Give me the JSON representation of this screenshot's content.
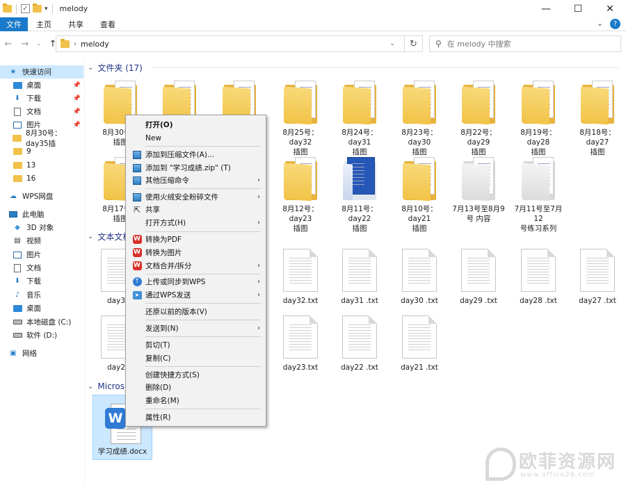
{
  "window": {
    "title": "melody"
  },
  "ribbon": {
    "tabs": [
      "文件",
      "主页",
      "共享",
      "查看"
    ]
  },
  "address": {
    "path": "melody",
    "search_placeholder": "在 melody 中搜索"
  },
  "sidebar": {
    "items": [
      {
        "label": "快速访问",
        "icon": "star-icon"
      },
      {
        "label": "桌面",
        "icon": "desktop-icon",
        "pinned": true
      },
      {
        "label": "下载",
        "icon": "download-icon",
        "pinned": true
      },
      {
        "label": "文档",
        "icon": "document-icon",
        "pinned": true
      },
      {
        "label": "图片",
        "icon": "picture-icon",
        "pinned": true
      },
      {
        "label": "8月30号：day35插",
        "icon": "folder-icon"
      },
      {
        "label": "9",
        "icon": "folder-icon"
      },
      {
        "label": "13",
        "icon": "folder-icon"
      },
      {
        "label": "16",
        "icon": "folder-icon"
      },
      {
        "label": "WPS网盘",
        "icon": "cloud-icon"
      },
      {
        "label": "此电脑",
        "icon": "pc-icon"
      },
      {
        "label": "3D 对象",
        "icon": "3d-icon"
      },
      {
        "label": "视频",
        "icon": "video-icon"
      },
      {
        "label": "图片",
        "icon": "picture-icon"
      },
      {
        "label": "文档",
        "icon": "document-icon"
      },
      {
        "label": "下载",
        "icon": "download-icon"
      },
      {
        "label": "音乐",
        "icon": "music-icon"
      },
      {
        "label": "桌面",
        "icon": "desktop-icon"
      },
      {
        "label": "本地磁盘 (C:)",
        "icon": "drive-icon"
      },
      {
        "label": "软件 (D:)",
        "icon": "drive-icon"
      },
      {
        "label": "网络",
        "icon": "network-icon"
      }
    ]
  },
  "groups": {
    "folders": {
      "header": "文件夹 (17)"
    },
    "text_docs": {
      "header": "文本文档"
    },
    "microsoft": {
      "header": "Micros"
    }
  },
  "folders_row1": [
    {
      "label1": "8月30号：",
      "label2": "插图"
    },
    {
      "label1": "",
      "label2": ""
    },
    {
      "label1": "",
      "label2": ""
    },
    {
      "label1": "8月25号：day32",
      "label2": "插图"
    },
    {
      "label1": "8月24号：day31",
      "label2": "插图"
    },
    {
      "label1": "8月23号：day30",
      "label2": "插图"
    },
    {
      "label1": "8月22号：day29",
      "label2": "插图"
    },
    {
      "label1": "8月19号：day28",
      "label2": "插图"
    },
    {
      "label1": "8月18号：day27",
      "label2": "插图"
    }
  ],
  "folders_row2": [
    {
      "label1": "8月17号：",
      "label2": "插图"
    },
    {
      "label1": "8月12号：day23",
      "label2": "插图"
    },
    {
      "label1": "8月11号：day22",
      "label2": "插图"
    },
    {
      "label1": "8月10号：day21",
      "label2": "插图"
    },
    {
      "label1": "7月13号至8月9",
      "label2": "号 内容"
    },
    {
      "label1": "7月11号至7月12",
      "label2": "号练习系列"
    }
  ],
  "txt_row1": [
    "day35",
    "day32.txt",
    "day31 .txt",
    "day30 .txt",
    "day29 .txt",
    "day28 .txt",
    "day27 .txt"
  ],
  "txt_row2": [
    "day26",
    "day23.txt",
    "day22 .txt",
    "day21 .txt"
  ],
  "docx": {
    "label": "学习成绩.docx"
  },
  "context_menu": {
    "open": "打开(O)",
    "new": "New",
    "add_archive": "添加到压缩文件(A)...",
    "add_zip": "添加到 \"学习成绩.zip\" (T)",
    "other_compress": "其他压缩命令",
    "shred": "使用火绒安全粉碎文件",
    "share": "共享",
    "open_with": "打开方式(H)",
    "to_pdf": "转换为PDF",
    "to_image": "转换为图片",
    "merge_split": "文档合并/拆分",
    "upload_wps": "上传或同步到WPS",
    "send_wps": "通过WPS发送",
    "restore": "还原以前的版本(V)",
    "send_to": "发送到(N)",
    "cut": "剪切(T)",
    "copy": "复制(C)",
    "shortcut": "创建快捷方式(S)",
    "delete": "删除(D)",
    "rename": "重命名(M)",
    "properties": "属性(R)"
  },
  "watermark": {
    "text": "欧菲资源网",
    "url": "www.office26.com"
  }
}
